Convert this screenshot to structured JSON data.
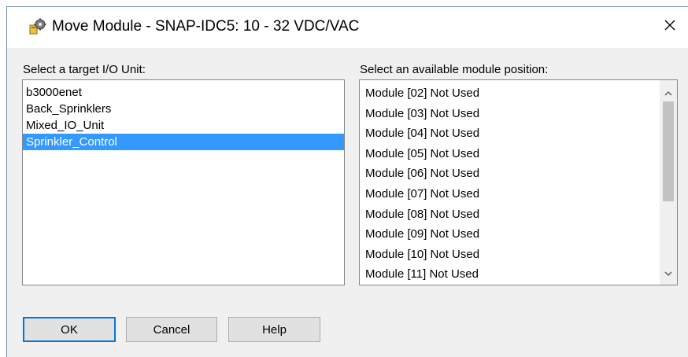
{
  "window": {
    "title": "Move Module - SNAP-IDC5: 10 - 32 VDC/VAC",
    "icon": "gear-module-icon",
    "close_glyph": "✕"
  },
  "left_panel": {
    "label": "Select a target I/O Unit:",
    "items": [
      "b3000enet",
      "Back_Sprinklers",
      "Mixed_IO_Unit",
      "Sprinkler_Control"
    ],
    "selected": "Sprinkler_Control"
  },
  "right_panel": {
    "label": "Select an available module position:",
    "items": [
      "Module [02] Not Used",
      "Module [03] Not Used",
      "Module [04] Not Used",
      "Module [05] Not Used",
      "Module [06] Not Used",
      "Module [07] Not Used",
      "Module [08] Not Used",
      "Module [09] Not Used",
      "Module [10] Not Used",
      "Module [11] Not Used"
    ]
  },
  "buttons": {
    "ok": "OK",
    "cancel": "Cancel",
    "help": "Help"
  },
  "colors": {
    "selection": "#3399ff",
    "default_button_border": "#0078d7"
  }
}
